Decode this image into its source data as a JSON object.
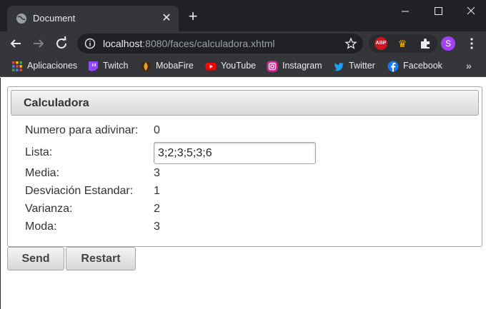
{
  "browser": {
    "tab_title": "Document",
    "url_host": "localhost",
    "url_path": ":8080/faces/calculadora.xhtml",
    "avatar_letter": "S",
    "bookmarks": [
      {
        "label": "Aplicaciones",
        "icon": "apps-grid-icon"
      },
      {
        "label": "Twitch",
        "icon": "twitch-icon"
      },
      {
        "label": "MobaFire",
        "icon": "mobafire-icon"
      },
      {
        "label": "YouTube",
        "icon": "youtube-icon"
      },
      {
        "label": "Instagram",
        "icon": "instagram-icon"
      },
      {
        "label": "Twitter",
        "icon": "twitter-icon"
      },
      {
        "label": "Facebook",
        "icon": "facebook-icon"
      }
    ],
    "bookmarks_more": "»",
    "abp_label": "ABP"
  },
  "panel": {
    "title": "Calculadora",
    "fields": {
      "numero_label": "Numero para adivinar:",
      "numero_value": "0",
      "lista_label": "Lista:",
      "lista_value": "3;2;3;5;3;6",
      "media_label": "Media:",
      "media_value": "3",
      "desviacion_label": "Desviación Estandar:",
      "desviacion_value": "1",
      "varianza_label": "Varianza:",
      "varianza_value": "2",
      "moda_label": "Moda:",
      "moda_value": "3"
    }
  },
  "actions": {
    "send_label": "Send",
    "restart_label": "Restart"
  },
  "colors": {
    "browser_dark": "#202124",
    "browser_toolbar": "#35363a",
    "panel_border": "#a8a8a8",
    "text": "#333333"
  }
}
